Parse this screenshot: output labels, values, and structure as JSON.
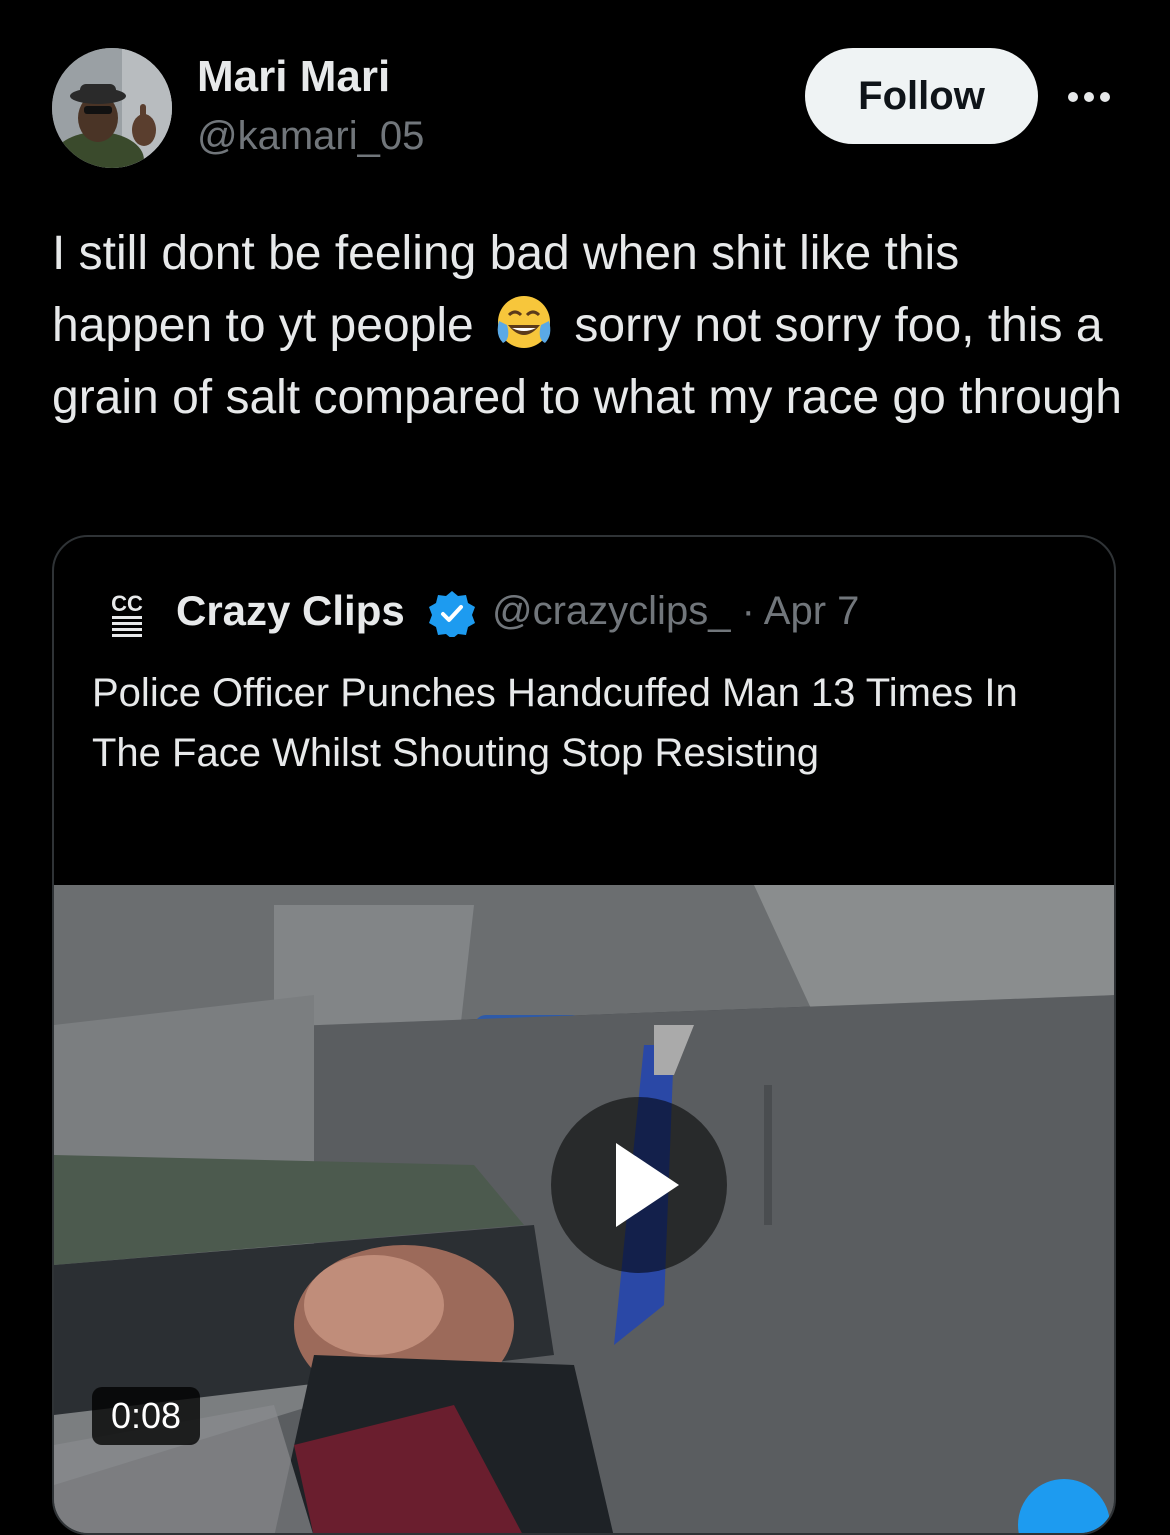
{
  "author": {
    "name": "Mari Mari",
    "handle": "@kamari_05",
    "avatar_icon": "profile-photo"
  },
  "follow_label": "Follow",
  "more_icon": "more-horizontal-icon",
  "tweet": {
    "text_part1": "I still dont be feeling bad when shit like this happen to yt people",
    "emoji": "😂",
    "text_part2": "sorry not sorry foo, this a grain of salt compared to what my race go through"
  },
  "quoted_tweet": {
    "logo_text": "CC",
    "name": "Crazy Clips",
    "verified_icon": "verified-badge-icon",
    "handle": "@crazyclips_",
    "separator": "·",
    "date": "Apr 7",
    "text": "Police Officer Punches Handcuffed Man 13 Times In The Face Whilst Shouting Stop Resisting",
    "video": {
      "duration": "0:08",
      "play_icon": "play-icon"
    }
  },
  "colors": {
    "background": "#000000",
    "text": "#e7e9ea",
    "secondary": "#71767b",
    "border": "#2f3336",
    "verified": "#1d9bf0",
    "follow_bg": "#eff3f4"
  }
}
